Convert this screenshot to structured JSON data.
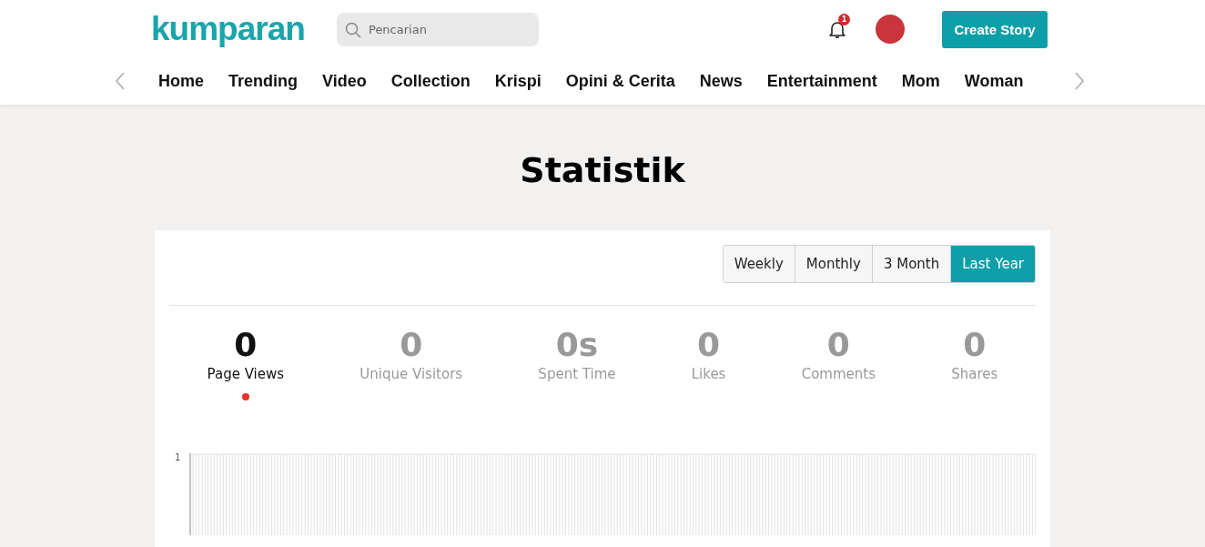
{
  "header": {
    "logo": "kumparan",
    "search": {
      "placeholder": "Pencarian"
    },
    "notification_count": "1",
    "create_button": "Create Story"
  },
  "nav": {
    "items": [
      {
        "label": "Home"
      },
      {
        "label": "Trending"
      },
      {
        "label": "Video"
      },
      {
        "label": "Collection"
      },
      {
        "label": "Krispi"
      },
      {
        "label": "Opini & Cerita"
      },
      {
        "label": "News"
      },
      {
        "label": "Entertainment"
      },
      {
        "label": "Mom"
      },
      {
        "label": "Woman"
      }
    ]
  },
  "page_title": "Statistik",
  "periods": [
    {
      "label": "Weekly",
      "selected": false
    },
    {
      "label": "Monthly",
      "selected": false
    },
    {
      "label": "3 Month",
      "selected": false
    },
    {
      "label": "Last Year",
      "selected": true
    }
  ],
  "stats": [
    {
      "value": "0",
      "label": "Page Views",
      "selected": true
    },
    {
      "value": "0",
      "label": "Unique Visitors",
      "selected": false
    },
    {
      "value": "0s",
      "label": "Spent Time",
      "selected": false
    },
    {
      "value": "0",
      "label": "Likes",
      "selected": false
    },
    {
      "value": "0",
      "label": "Comments",
      "selected": false
    },
    {
      "value": "0",
      "label": "Shares",
      "selected": false
    }
  ],
  "chart": {
    "y_tick": "1"
  }
}
